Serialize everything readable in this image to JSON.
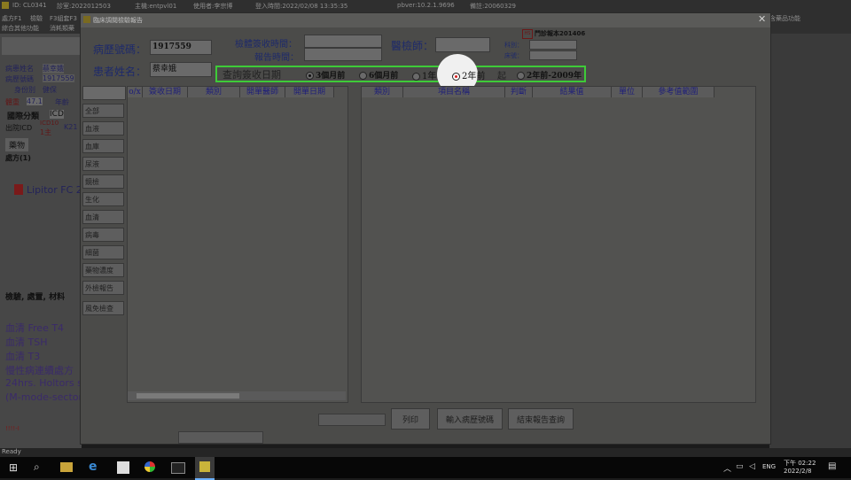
{
  "topbar": {
    "id": "ID: CL0341",
    "room": "診室:2022012503",
    "host": "主機:entpvl01",
    "user": "使用者:李宗博",
    "login": "登入時間:2022/02/08 13:35:35",
    "pbver": "pbver:10.2.1.9696",
    "note": "備註:20060329",
    "menu1": "處方F1",
    "menu2": "檢驗",
    "menu3": "F3組套F3",
    "menu4": "綜合其他功能",
    "menu5": "消耗類藥",
    "right_menu": "含藥品功能"
  },
  "left_bg": {
    "name_label": "病患姓名",
    "name_value": "蔡幸娥",
    "chart_label": "病歷號碼",
    "chart_value": "1917559",
    "id_label": "身份別",
    "id_value": "健保",
    "weight": "體重",
    "weight_value": "47.1",
    "age": "年齡",
    "intl": "國際分類",
    "icd": "ICD",
    "discharge_icd": "出院ICD",
    "icd10": "ICD10",
    "main": "1主",
    "k21": "K21",
    "drug": "藥物",
    "rx": "處方(1)",
    "lipitor": "Lipitor FC 2",
    "exam": "檢驗, 處置, 材料",
    "lab1": "血清 Free T4",
    "lab2": "血清 TSH",
    "lab3": "血清 T3",
    "lab4": "慢性病連續處方",
    "lab5": "24hrs. Holtors sc",
    "lab6": "(M-mode-sector-",
    "red_tag": "!!!!-I"
  },
  "dialog": {
    "title": "臨床調閱檢驗報告",
    "chart_no_label": "病歷號碼：",
    "chart_no": "1917559",
    "patient_label": "患者姓名：",
    "patient_name": "蔡幸娥",
    "sample_time_label": "檢體簽收時間：",
    "report_time_label": "報告時間：",
    "doctor_label": "醫檢師：",
    "outpatient": "門診報本201406",
    "dept_label": "科別：",
    "bed_label": "床號：",
    "query_label": "查詢簽收日期",
    "radios": [
      "3個月前",
      "6個月前",
      "1年前",
      "2年前"
    ],
    "selected_radio": "3個月前",
    "from_label": "起",
    "range_label": "2年前-2009年",
    "side_buttons": [
      "全部",
      "血液",
      "血庫",
      "尿液",
      "鏡檢",
      "生化",
      "血清",
      "病毒",
      "細菌",
      "藥物濃度",
      "外檢報告",
      "風免檢查"
    ],
    "left_headers": [
      "o/x",
      "簽收日期",
      "類別",
      "開單醫師",
      "開單日期"
    ],
    "right_headers": [
      "類別",
      "項目名稱",
      "判斷",
      "結果值",
      "單位",
      "參考值範圍"
    ],
    "print": "列印",
    "enter_chart": "輸入病歷號碼",
    "exit": "結束報告查詢"
  },
  "status": {
    "text": "Ready"
  },
  "taskbar": {
    "lang": "ENG",
    "time": "下午 02:22",
    "date": "2022/2/8"
  },
  "colors": {
    "highlight": "#3ecb38",
    "cursor": "#f2f2f2",
    "radio_dot": "#d42020"
  }
}
